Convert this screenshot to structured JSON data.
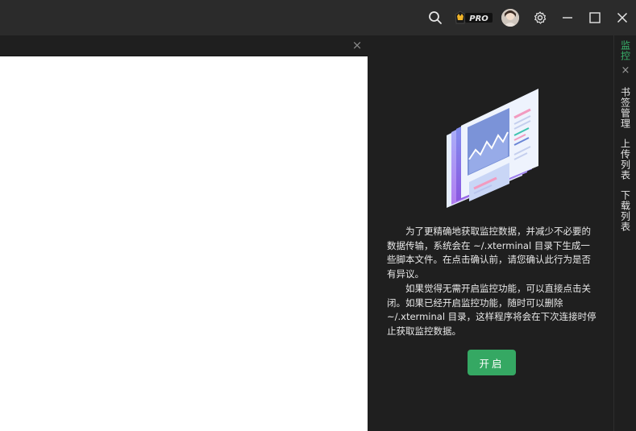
{
  "titlebar": {
    "pro_badge": "PRO",
    "icons": [
      "search-icon",
      "pro-crown-icon",
      "avatar",
      "gear-icon",
      "minimize-icon",
      "maximize-icon",
      "close-icon"
    ]
  },
  "subbar": {
    "close_glyph": "×"
  },
  "sidebar": {
    "tabs": [
      {
        "label": "监控",
        "active": true,
        "close_glyph": "×"
      },
      {
        "label": "书签管理",
        "active": false
      },
      {
        "label": "上传列表",
        "active": false
      },
      {
        "label": "下载列表",
        "active": false
      }
    ]
  },
  "monitor": {
    "paragraph1": "为了更精确地获取监控数据，并减少不必要的数据传输，系统会在 ~/.xterminal 目录下生成一些脚本文件。在点击确认前，请您确认此行为是否有异议。",
    "paragraph2": "如果觉得无需开启监控功能，可以直接点击关闭。如果已经开启监控功能，随时可以删除 ~/.xterminal 目录，这样程序将会在下次连接时停止获取监控数据。",
    "button_label": "开启"
  },
  "colors": {
    "accent": "#35a863",
    "active_tab": "#38b26b",
    "titlebar_bg": "#2b2b2b",
    "panel_bg": "#1f1f1f",
    "terminal_bg": "#ffffff"
  }
}
